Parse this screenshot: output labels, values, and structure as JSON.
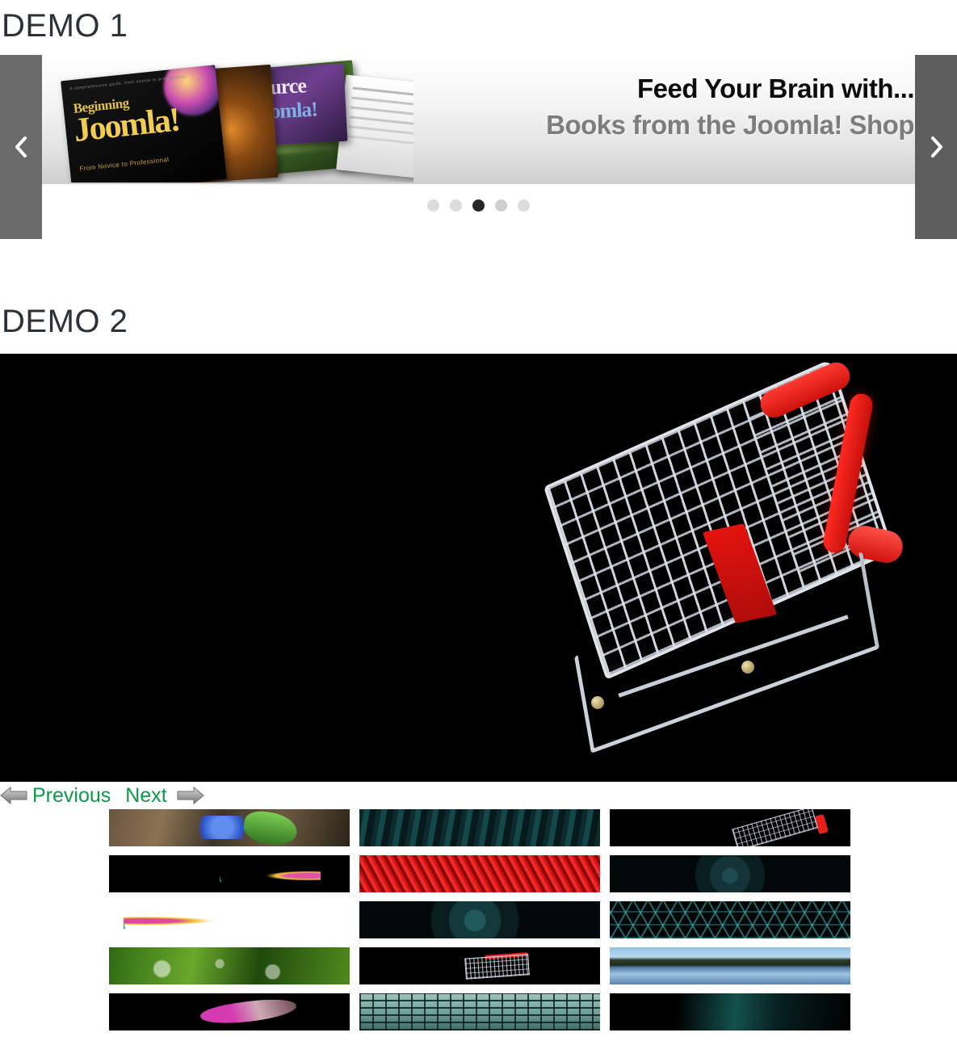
{
  "sections": {
    "demo1": {
      "heading": "DEMO 1",
      "carousel": {
        "prev_icon": "chevron-left-icon",
        "next_icon": "chevron-right-icon",
        "slide": {
          "banner_line1": "Feed Your Brain with...",
          "banner_line2": "Books from the Joomla! Shop",
          "book_title_small": "A comprehensive guide, from novice to professional",
          "book_title_beginning": "Beginning",
          "book_title_joomla": "Joomla!",
          "book_subtitle": "From Novice to Professional",
          "book_source_line1": "Source",
          "book_source_line2": "Joomla!"
        },
        "dots": [
          {
            "label": "1",
            "state": "inactive"
          },
          {
            "label": "2",
            "state": "inactive"
          },
          {
            "label": "3",
            "state": "active"
          },
          {
            "label": "4",
            "state": "inactive"
          },
          {
            "label": "5",
            "state": "inactive"
          }
        ],
        "active_dot_index": 3,
        "total_slides": 5
      }
    },
    "demo2": {
      "heading": "DEMO 2",
      "main_image": {
        "name": "shopping-cart-photo",
        "description": "Chrome shopping cart with red handle on black background"
      },
      "controls": {
        "previous_label": "Previous",
        "next_label": "Next",
        "previous_icon": "arrow-left-icon",
        "next_icon": "arrow-right-icon"
      },
      "thumbnails": [
        {
          "id": 1,
          "name": "blue-flower-leaves",
          "style": "t-leaves-blue"
        },
        {
          "id": 2,
          "name": "teal-blades",
          "style": "t-teal-blades"
        },
        {
          "id": 3,
          "name": "shopping-cart-dark",
          "style": "t-cart-dark"
        },
        {
          "id": 4,
          "name": "flower-line-art",
          "style": "t-flower-line"
        },
        {
          "id": 5,
          "name": "red-grass",
          "style": "t-red-grass"
        },
        {
          "id": 6,
          "name": "hud-circles-dark",
          "style": "t-hud-dark"
        },
        {
          "id": 7,
          "name": "flower-white-bg",
          "style": "t-flower-white"
        },
        {
          "id": 8,
          "name": "hud-circles-teal",
          "style": "t-hud-dark2"
        },
        {
          "id": 9,
          "name": "honeycomb-mesh",
          "style": "t-honeycomb"
        },
        {
          "id": 10,
          "name": "dewy-grass",
          "style": "t-dewy-grass"
        },
        {
          "id": 11,
          "name": "shopping-cart-red",
          "style": "t-cart-red"
        },
        {
          "id": 12,
          "name": "lake-forest",
          "style": "t-lake"
        },
        {
          "id": 13,
          "name": "pink-spike-flower",
          "style": "t-pink-spike"
        },
        {
          "id": 14,
          "name": "green-grid-floor",
          "style": "t-grid-floor"
        },
        {
          "id": 15,
          "name": "teal-streak-dark",
          "style": "t-teal-streak"
        }
      ]
    }
  },
  "colors": {
    "heading": "#2c3338",
    "link_green": "#0a9a4a",
    "carousel_nav_bg": "#6b6b6b",
    "dot_active": "#262626",
    "dot_inactive": "#dcdcdc",
    "stage_bg": "#000000",
    "banner_title": "#0d0d0d",
    "banner_subtitle": "#7d7d7d"
  }
}
